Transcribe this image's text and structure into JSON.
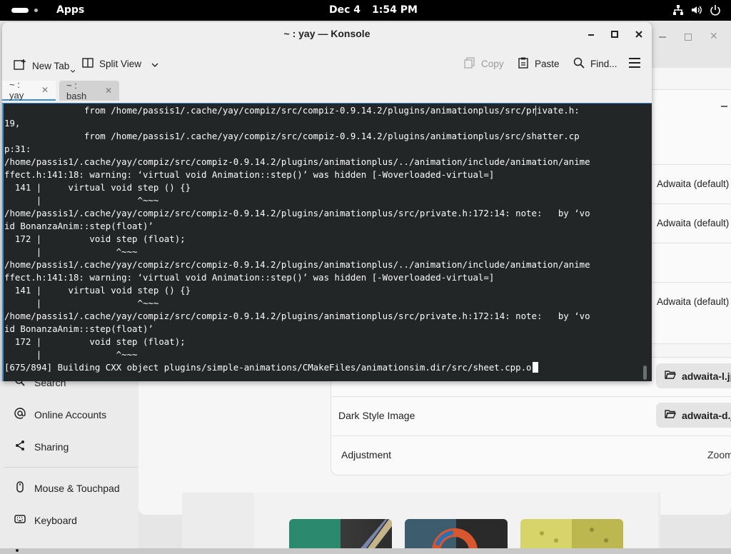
{
  "topbar": {
    "apps_label": "Apps",
    "date": "Dec 4",
    "time": "1:54 PM",
    "tray_icons": [
      "network-icon",
      "volume-icon",
      "power-icon"
    ]
  },
  "konsole": {
    "title": "~ : yay — Konsole",
    "toolbar": {
      "new_tab": "New Tab",
      "split_view": "Split View",
      "copy": "Copy",
      "paste": "Paste",
      "find": "Find..."
    },
    "tabs": [
      {
        "label": "~ : yay",
        "active": true
      },
      {
        "label": "~ : bash",
        "active": false
      }
    ],
    "terminal_lines": [
      "               from /home/passis1/.cache/yay/compiz/src/compiz-0.9.14.2/plugins/animationplus/src/private.h:",
      "19,",
      "               from /home/passis1/.cache/yay/compiz/src/compiz-0.9.14.2/plugins/animationplus/src/shatter.cp",
      "p:31:",
      "/home/passis1/.cache/yay/compiz/src/compiz-0.9.14.2/plugins/animationplus/../animation/include/animation/anime",
      "ffect.h:141:18: warning: ‘virtual void Animation::step()’ was hidden [-Woverloaded-virtual=]",
      "  141 |     virtual void step () {}",
      "      |                  ^~~~",
      "/home/passis1/.cache/yay/compiz/src/compiz-0.9.14.2/plugins/animationplus/src/private.h:172:14: note:   by ‘vo",
      "id BonanzaAnim::step(float)’",
      "  172 |         void step (float);",
      "      |              ^~~~",
      "/home/passis1/.cache/yay/compiz/src/compiz-0.9.14.2/plugins/animationplus/../animation/include/animation/anime",
      "ffect.h:141:18: warning: ‘virtual void Animation::step()’ was hidden [-Woverloaded-virtual=]",
      "  141 |     virtual void step () {}",
      "      |                  ^~~~",
      "/home/passis1/.cache/yay/compiz/src/compiz-0.9.14.2/plugins/animationplus/src/private.h:172:14: note:   by ‘vo",
      "id BonanzaAnim::step(float)’",
      "  172 |         void step (float);",
      "      |              ^~~~"
    ],
    "prompt_line": "[675/894] Building CXX object plugins/simple-animations/CMakeFiles/animationsim.dir/src/sheet.cpp.o"
  },
  "settings_bg": {
    "sidebar": {
      "partial_item": "Search",
      "items": [
        "Online Accounts",
        "Sharing",
        "Mouse & Touchpad",
        "Keyboard"
      ]
    },
    "theme_rows": [
      "Adwaita (default)",
      "Adwaita (default)",
      "Adwaita (default)"
    ],
    "style_rows": {
      "dark_style_image_label": "Dark Style Image",
      "adjustment_label": "Adjustment",
      "light_file": "adwaita-l.jpg",
      "dark_file": "adwaita-d.jpg",
      "adjustment_value": "Zoom"
    }
  },
  "colors": {
    "terminal_bg": "#232627",
    "terminal_fg": "#fcfcfc",
    "accent": "#3e8ed0"
  }
}
